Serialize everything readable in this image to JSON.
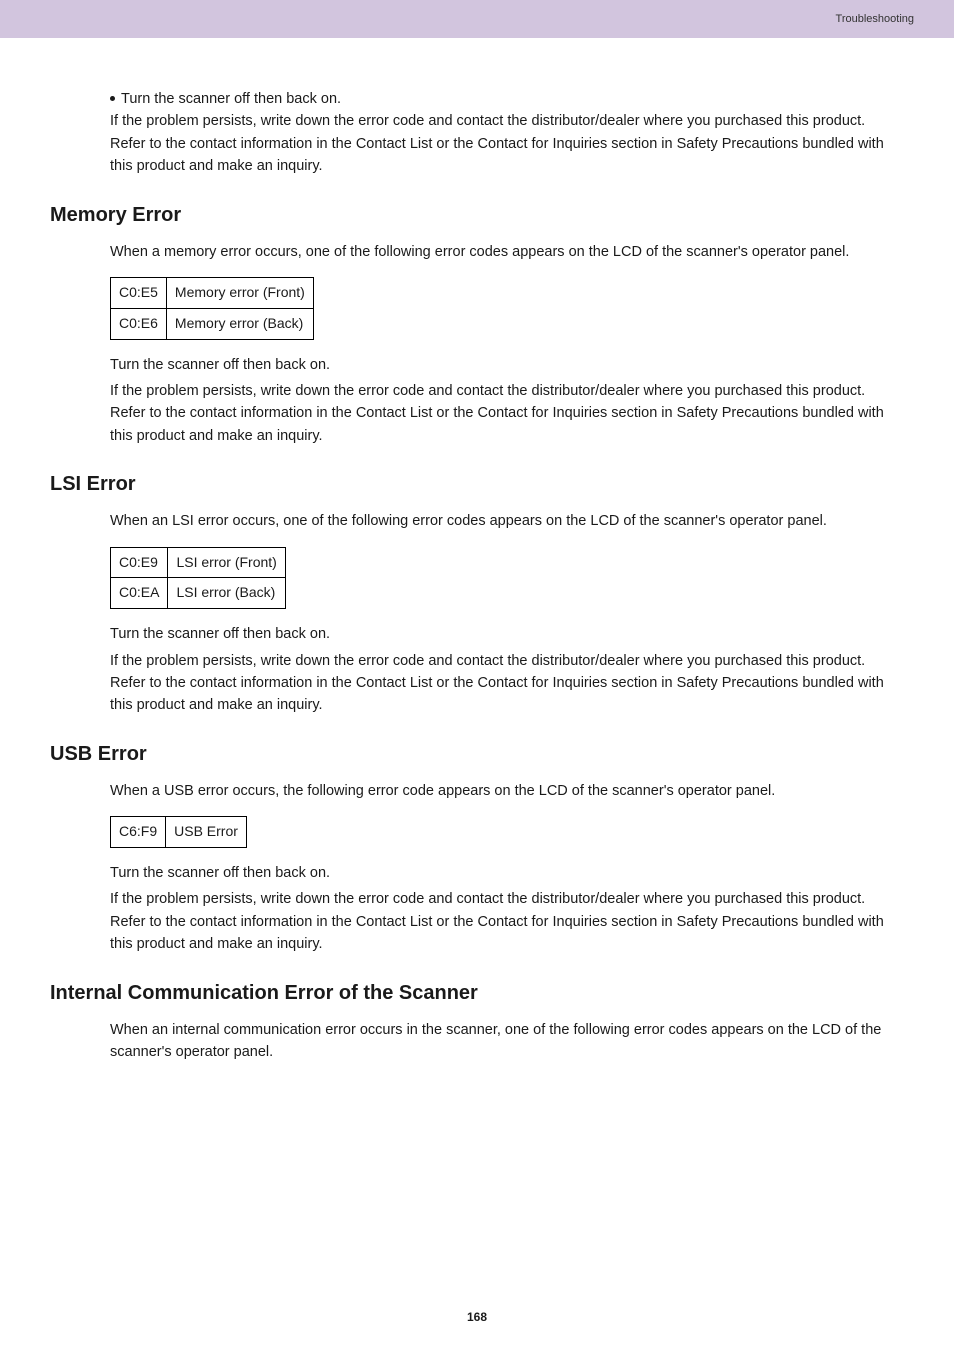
{
  "header": {
    "breadcrumb": "Troubleshooting"
  },
  "intro": {
    "bullet": "Turn the scanner off then back on.",
    "persist": "If the problem persists, write down the error code and contact the distributor/dealer where you purchased this product. Refer to the contact information in the Contact List or the Contact for Inquiries section in Safety Precautions bundled with this product and make an inquiry."
  },
  "sections": {
    "memory": {
      "title": "Memory Error",
      "intro": "When a memory error occurs, one of the following error codes appears on the LCD of the scanner's operator panel.",
      "rows": [
        {
          "code": "C0:E5",
          "desc": "Memory error (Front)"
        },
        {
          "code": "C0:E6",
          "desc": "Memory error (Back)"
        }
      ],
      "after1": "Turn the scanner off then back on.",
      "after2": "If the problem persists, write down the error code and contact the distributor/dealer where you purchased this product. Refer to the contact information in the Contact List or the Contact for Inquiries section in Safety Precautions bundled with this product and make an inquiry."
    },
    "lsi": {
      "title": "LSI Error",
      "intro": "When an LSI error occurs, one of the following error codes appears on the LCD of the scanner's operator panel.",
      "rows": [
        {
          "code": "C0:E9",
          "desc": "LSI error (Front)"
        },
        {
          "code": "C0:EA",
          "desc": "LSI error (Back)"
        }
      ],
      "after1": "Turn the scanner off then back on.",
      "after2": "If the problem persists, write down the error code and contact the distributor/dealer where you purchased this product. Refer to the contact information in the Contact List or the Contact for Inquiries section in Safety Precautions bundled with this product and make an inquiry."
    },
    "usb": {
      "title": "USB Error",
      "intro": "When a USB error occurs, the following error code appears on the LCD of the scanner's operator panel.",
      "rows": [
        {
          "code": "C6:F9",
          "desc": "USB Error"
        }
      ],
      "after1": "Turn the scanner off then back on.",
      "after2": "If the problem persists, write down the error code and contact the distributor/dealer where you purchased this product. Refer to the contact information in the Contact List or the Contact for Inquiries section in Safety Precautions bundled with this product and make an inquiry."
    },
    "internal": {
      "title": "Internal Communication Error of the Scanner",
      "intro": "When an internal communication error occurs in the scanner, one of the following error codes appears on the LCD of the scanner's operator panel."
    }
  },
  "footer": {
    "page": "168"
  }
}
